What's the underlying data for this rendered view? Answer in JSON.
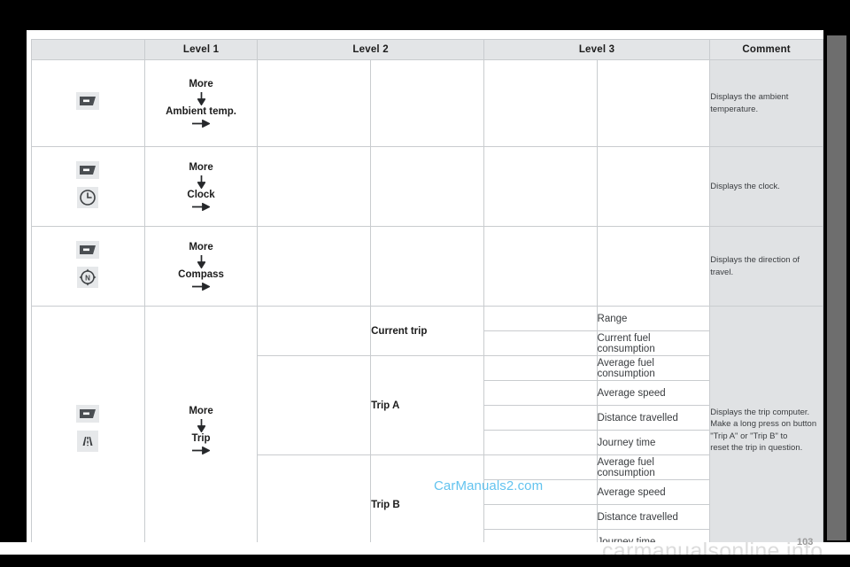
{
  "document": {
    "page_number": "103",
    "watermark_center": "CarManuals2.com",
    "watermark_bottom": "carmanualsonline.info",
    "accent_watermark_color": "#63c3ef",
    "comment_bg_color": "#e0e2e4",
    "header_bg_color": "#e3e5e7",
    "grid_line_color": "#c9cccf"
  },
  "table": {
    "headers": {
      "level1": "Level 1",
      "level2": "Level 2",
      "level3": "Level 3",
      "comment": "Comment"
    },
    "rows": [
      {
        "id": "ambient-temp",
        "icons": [
          "display-screen-icon"
        ],
        "level1": {
          "menu": "More",
          "item": "Ambient temp."
        },
        "level2": [],
        "level3": [],
        "comment_lines": [
          "Displays the ambient temperature."
        ]
      },
      {
        "id": "clock",
        "icons": [
          "display-screen-icon",
          "clock-icon"
        ],
        "level1": {
          "menu": "More",
          "item": "Clock"
        },
        "level2": [],
        "level3": [],
        "comment_lines": [
          "Displays the clock."
        ]
      },
      {
        "id": "compass",
        "icons": [
          "display-screen-icon",
          "compass-icon"
        ],
        "level1": {
          "menu": "More",
          "item": "Compass"
        },
        "level2": [],
        "level3": [],
        "comment_lines": [
          "Displays the direction of travel."
        ]
      },
      {
        "id": "trip",
        "icons": [
          "display-screen-icon",
          "road-icon"
        ],
        "level1": {
          "menu": "More",
          "item": "Trip"
        },
        "level2": [
          "Current trip",
          "Trip A",
          "Trip B"
        ],
        "level3": [
          "Range",
          "Current fuel consumption",
          "Average fuel consumption",
          "Average speed",
          "Distance travelled",
          "Journey time",
          "Average fuel consumption",
          "Average speed",
          "Distance travelled",
          "Journey time"
        ],
        "comment_lines": [
          "Displays the trip computer.",
          "Make a long press on button \"Trip A\" or \"Trip B\" to",
          "reset the trip in question."
        ]
      }
    ]
  }
}
